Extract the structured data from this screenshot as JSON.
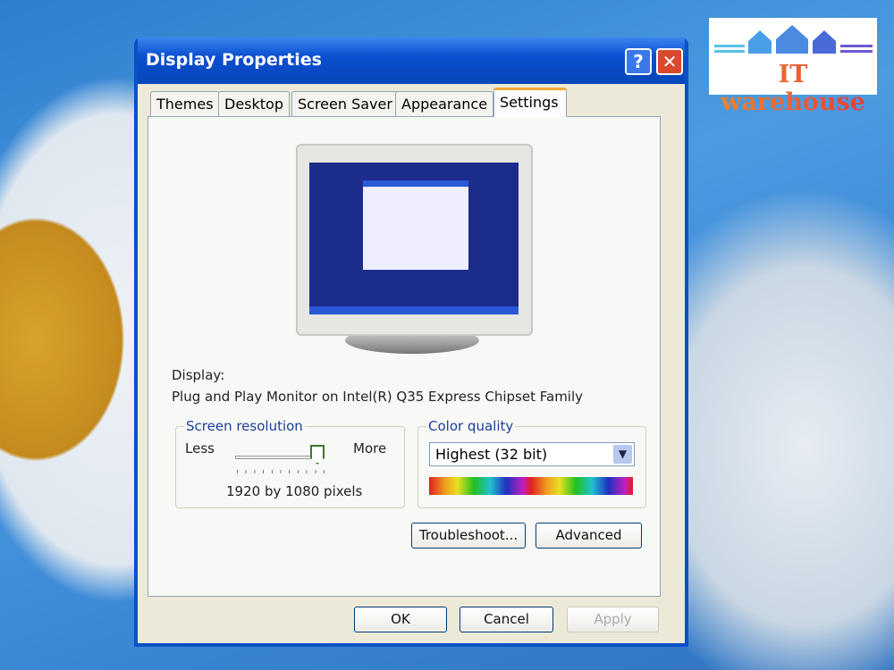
{
  "logo": {
    "text": "IT warehouse"
  },
  "dialog": {
    "title": "Display Properties",
    "help_label": "?",
    "close_label": "✕",
    "tabs": [
      {
        "label": "Themes"
      },
      {
        "label": "Desktop"
      },
      {
        "label": "Screen Saver"
      },
      {
        "label": "Appearance"
      },
      {
        "label": "Settings"
      }
    ],
    "active_tab": "Settings",
    "display_label": "Display:",
    "display_value": "Plug and Play Monitor on Intel(R) Q35 Express Chipset Family",
    "resolution": {
      "legend": "Screen resolution",
      "less": "Less",
      "more": "More",
      "value": "1920 by 1080 pixels",
      "slider_level": 1.0
    },
    "color_quality": {
      "legend": "Color quality",
      "selected": "Highest (32 bit)"
    },
    "buttons": {
      "troubleshoot": "Troubleshoot...",
      "advanced": "Advanced",
      "ok": "OK",
      "cancel": "Cancel",
      "apply": "Apply"
    }
  }
}
